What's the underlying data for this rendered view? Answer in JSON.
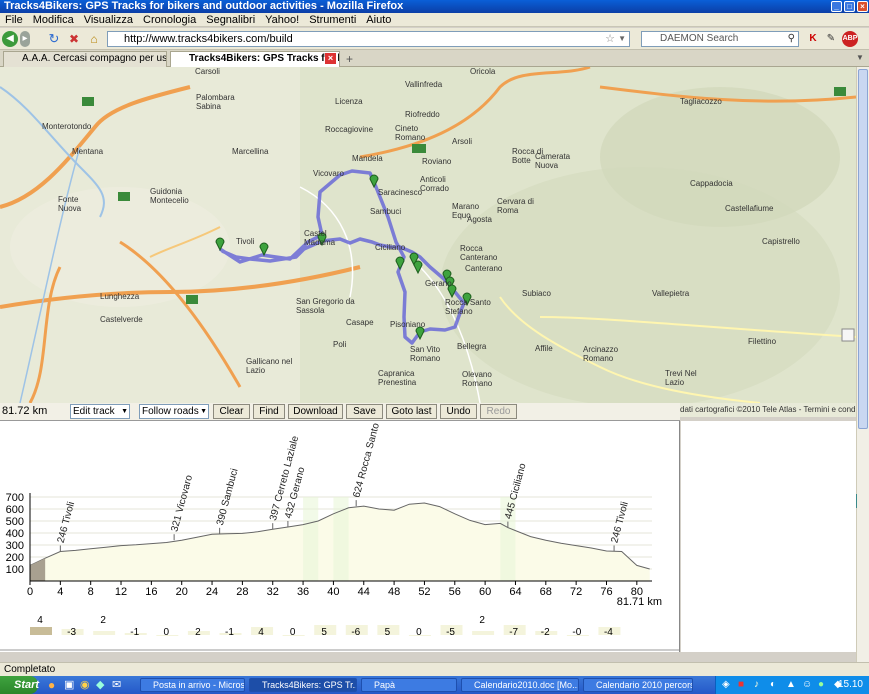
{
  "window": {
    "title": "Tracks4Bikers: GPS Tracks for bikers and outdoor activities - Mozilla Firefox"
  },
  "menu": [
    "File",
    "Modifica",
    "Visualizza",
    "Cronologia",
    "Segnalibri",
    "Yahoo!",
    "Strumenti",
    "Aiuto"
  ],
  "nav": {
    "url": "http://www.tracks4bikers.com/build",
    "search_placeholder": "DAEMON Search"
  },
  "tabs": [
    {
      "label": "A.A.A. Cercasi compagno per uscite zo..."
    },
    {
      "label": "Tracks4Bikers: GPS Tracks for bi..."
    }
  ],
  "map": {
    "labels": {
      "carsoli": "Carsoli",
      "oricola": "Oricola",
      "mandela": "Mandela",
      "vicovaro": "Vicovaro",
      "saracinesco": "Saracinesco",
      "sambuci": "Sambuci",
      "tivoli": "Tivoli",
      "ciciliano": "Ciciliano",
      "gerano": "Gerano",
      "pisoniano": "Pisoniano",
      "subiaco": "Subiaco",
      "guidonia": "Guidonia Montecelio",
      "marcellina": "Marcellina",
      "palombara": "Palombara Sabina",
      "roccagiovine": "Roccagiovine",
      "licenza": "Licenza",
      "tagliacozzo": "Tagliacozzo",
      "cappadocia": "Cappadocia",
      "filettino": "Filettino",
      "trevi": "Trevi Nel Lazio",
      "bellegra": "Bellegra",
      "affile": "Affile",
      "poli": "Poli",
      "casape": "Casape",
      "capranica": "Capranica Prenestina",
      "olevano": "Olevano Romano",
      "sanvito": "San Vito Romano",
      "gallicano": "Gallicano nel Lazio",
      "sangregorio": "San Gregorio da Sassola",
      "monterotondo": "Monterotondo",
      "mentana": "Mentana",
      "fonte_nuova": "Fonte Nuova",
      "castelmadama": "Castel Madama",
      "castellafiume": "Castellafiume",
      "capistrello": "Capistrello",
      "vallepietra": "Vallepietra",
      "arcinazzo": "Arcinazzo Romano",
      "riofreddo": "Riofreddo",
      "vallinfreda": "Vallinfreda",
      "cineto": "Cineto Romano",
      "rocca_botte": "Rocca di Botte",
      "camerata": "Camerata Nuova",
      "cervara": "Cervara di Roma",
      "canterano": "Canterano",
      "rocca_canterano": "Rocca Canterano",
      "roccasanto": "Rocca Santo Stefano",
      "agosta": "Agosta",
      "anticoli": "Anticoli Corrado",
      "roviano": "Roviano",
      "arsoli": "Arsoli",
      "marano": "Marano Equo",
      "lunghezza": "Lunghezza",
      "castelverde": "Castelverde"
    },
    "copyright": "dati cartografici ©2010 Tele Atlas - Termini e condizioni d'uso"
  },
  "toolbar": {
    "distance": "81.72 km",
    "mode": "Edit track",
    "routing": "Follow roads",
    "buttons": {
      "clear": "Clear",
      "find": "Find",
      "download": "Download",
      "save": "Save",
      "goto_last": "Goto last",
      "undo": "Undo",
      "redo": "Redo"
    }
  },
  "chart_data": {
    "type": "area",
    "yticks": [
      100,
      200,
      300,
      400,
      500,
      600,
      700
    ],
    "xticks": [
      0,
      4,
      8,
      12,
      16,
      20,
      24,
      28,
      32,
      36,
      40,
      44,
      48,
      52,
      56,
      60,
      64,
      68,
      72,
      76,
      80
    ],
    "x_end_label": "81.71 km",
    "ylim": [
      0,
      750
    ],
    "xlim": [
      0,
      82
    ],
    "series": [
      {
        "x": [
          0,
          2,
          4,
          6,
          8,
          10,
          12,
          14,
          16,
          18,
          20,
          22,
          24,
          26,
          28,
          30,
          32,
          34,
          36,
          38,
          40,
          42,
          44,
          46,
          48,
          50,
          52,
          54,
          56,
          58,
          60,
          62,
          63,
          64,
          66,
          68,
          70,
          72,
          74,
          76,
          78,
          80,
          81.7
        ],
        "values": [
          130,
          190,
          246,
          255,
          268,
          282,
          295,
          302,
          312,
          321,
          340,
          365,
          390,
          393,
          397,
          410,
          432,
          450,
          470,
          500,
          560,
          610,
          624,
          600,
          590,
          640,
          650,
          620,
          560,
          505,
          470,
          480,
          445,
          420,
          370,
          340,
          315,
          295,
          275,
          250,
          246,
          130,
          100
        ]
      }
    ],
    "waypoints": [
      {
        "x": 4,
        "label": "246 Tivoli"
      },
      {
        "x": 19,
        "label": "321 Vicovaro"
      },
      {
        "x": 25,
        "label": "390 Sambuci"
      },
      {
        "x": 32,
        "label": "397 Cerreto Laziale"
      },
      {
        "x": 34,
        "label": "432 Gerano"
      },
      {
        "x": 43,
        "label": "624 Rocca Santo Stefano"
      },
      {
        "x": 63,
        "label": "445 Ciciliano"
      },
      {
        "x": 77,
        "label": "246 Tivoli"
      }
    ],
    "gradients": [
      "4",
      "-3",
      "2",
      "-1",
      "0",
      "2",
      "-1",
      "4",
      "0",
      "5",
      "-6",
      "5",
      "0",
      "-5",
      "2",
      "-7",
      "-2",
      "-0",
      "-4"
    ]
  },
  "status": {
    "text": "Completato"
  },
  "taskbar": {
    "start": "Start",
    "tasks": [
      "Posta in arrivo - Microsof...",
      "Tracks4Bikers: GPS Tr...",
      "Papà",
      "Calendario2010.doc [Mo...",
      "Calendario 2010 percorsi..."
    ],
    "clock": "15.10"
  },
  "colors": {
    "route": "#6a6ad6",
    "profile_fill": "#fbfbe8",
    "highway": "#f0a050",
    "marker": "#3ea33e"
  }
}
